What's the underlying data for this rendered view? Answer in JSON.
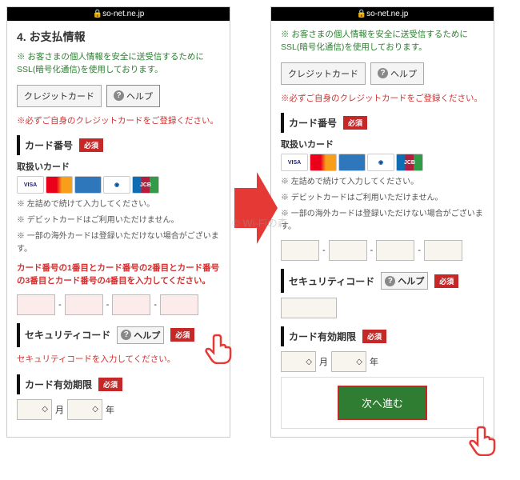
{
  "statusbar": "🔒so-net.ne.jp",
  "left": {
    "heading": "4. お支払情報",
    "ssl": "※ お客さまの個人情報を安全に送受信するためにSSL(暗号化通信)を使用しております。",
    "tab_credit": "クレジットカード",
    "help": "ヘルプ",
    "warn_own": "※必ずご自身のクレジットカードをご登録ください。",
    "cardnum_h": "カード番号",
    "required": "必須",
    "accepted_h": "取扱いカード",
    "bul1": "※ 左詰めで続けて入力してください。",
    "bul2": "※ デビットカードはご利用いただけません。",
    "bul3": "※ 一部の海外カードは登録いただけない場合がございます。",
    "err_cardnum": "カード番号の1番目とカード番号の2番目とカード番号の3番目とカード番号の4番目を入力してください。",
    "sec_h": "セキュリティコード",
    "err_sec": "セキュリティコードを入力してください。",
    "exp_h": "カード有効期限",
    "month": "月",
    "year": "年"
  },
  "right": {
    "next": "次へ進む"
  },
  "cards": {
    "visa": "VISA",
    "mc": "MasterCard",
    "amex": "AMEX",
    "diners": "Diners Club",
    "jcb": "JCB"
  },
  "watermark": "© Wi-Fiの森"
}
